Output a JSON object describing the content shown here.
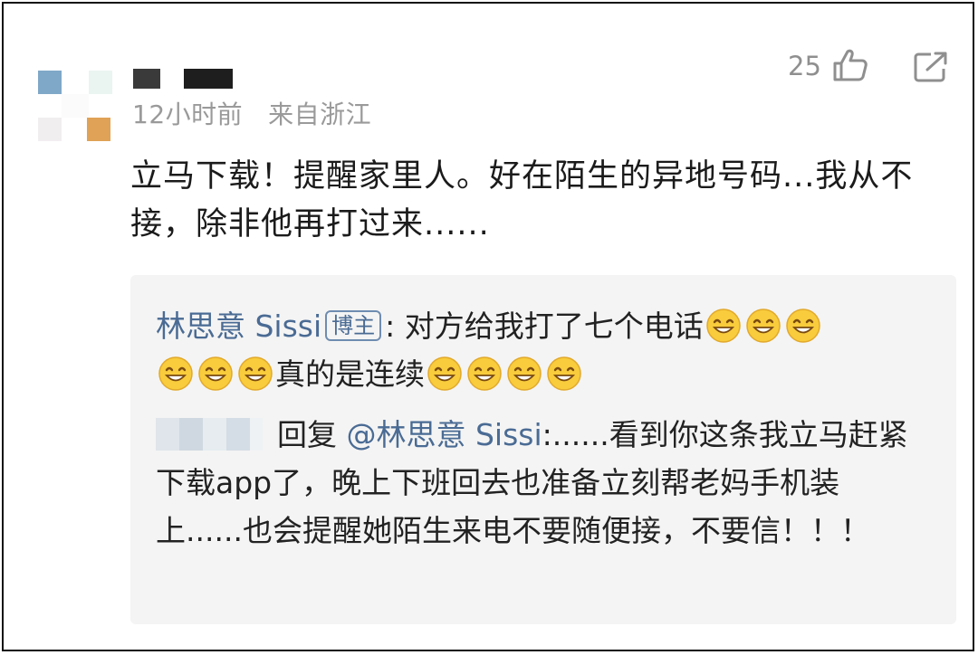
{
  "comment": {
    "time": "12小时前",
    "location": "来自浙江",
    "like_count": "25",
    "text": "立马下载！提醒家里人。好在陌生的异地号码...我从不接，除非他再打过来......"
  },
  "reply_block": {
    "quoted_author": "林思意 Sissi",
    "quoted_badge": "博主",
    "quoted_separator": ":",
    "quoted_text_part1": " 对方给我打了七个电话",
    "quoted_text_part2": "真的是连续",
    "reply_label": "回复",
    "reply_mention": "@林思意 Sissi",
    "reply_text": ":......看到你这条我立马赶紧下载app了，晚上下班回去也准备立刻帮老妈手机装上......也会提醒她陌生来电不要随便接，不要信！！！"
  },
  "icons": {
    "like": "thumbs-up-icon",
    "share": "share-external-icon",
    "emoji": "grinning-face-emoji"
  },
  "colors": {
    "link": "#4a6b94",
    "meta": "#9a9a9a",
    "reply_bg": "#f4f4f4"
  }
}
